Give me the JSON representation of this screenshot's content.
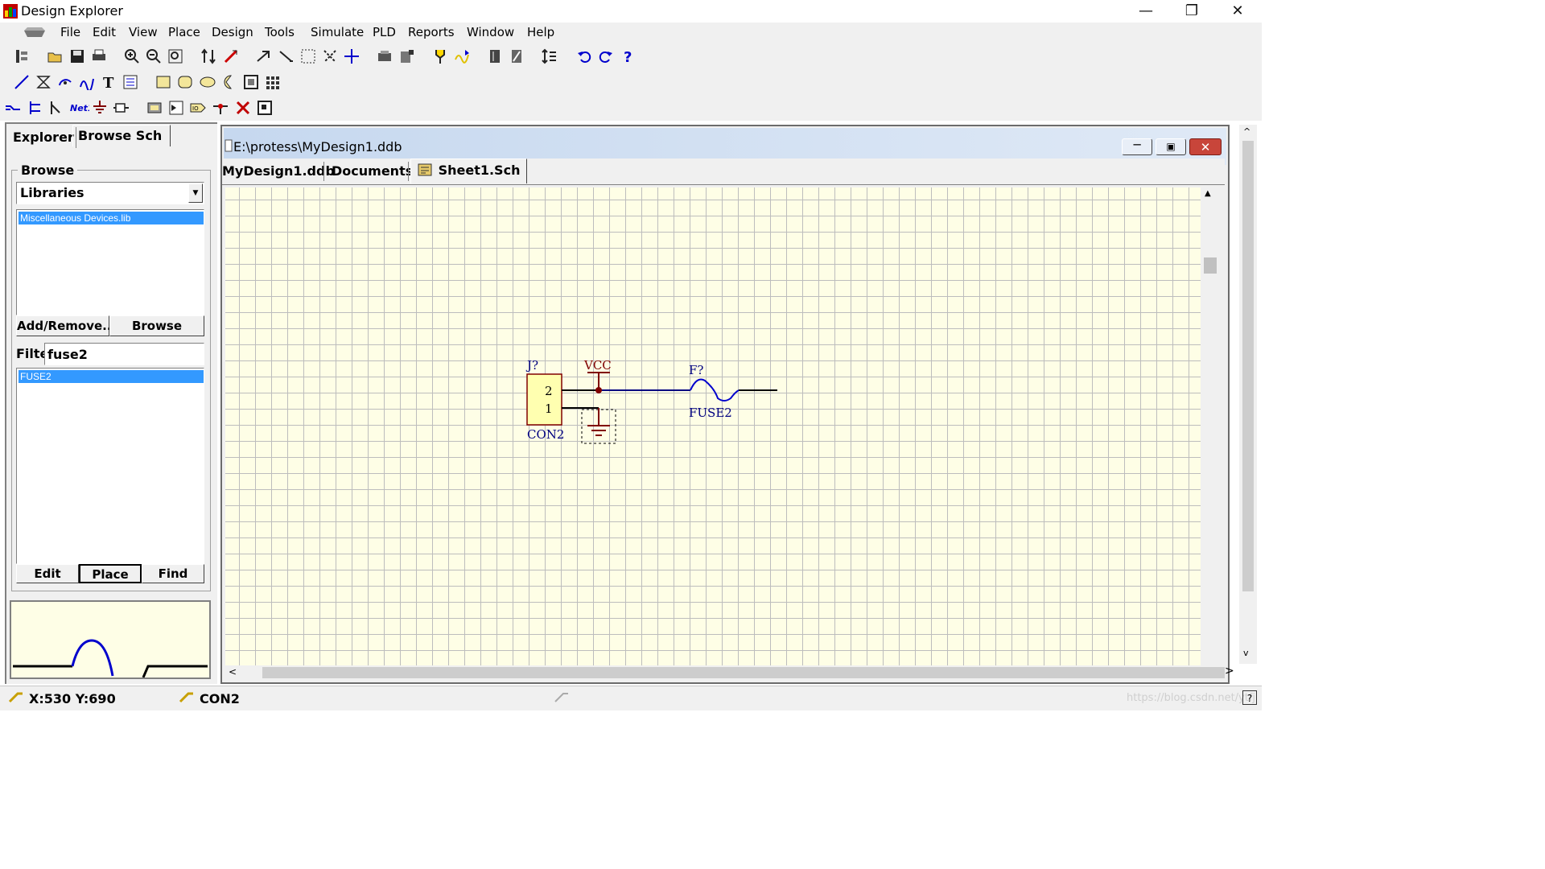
{
  "window": {
    "title": "Design Explorer"
  },
  "menu": [
    "File",
    "Edit",
    "View",
    "Place",
    "Design",
    "Tools",
    "Simulate",
    "PLD",
    "Reports",
    "Window",
    "Help"
  ],
  "panel": {
    "tabs": [
      "Explorer",
      "Browse Sch"
    ],
    "browse_label": "Browse",
    "browse_select": "Libraries",
    "libraries": [
      "Miscellaneous Devices.lib"
    ],
    "add_remove_label": "Add/Remove...",
    "browse_button": "Browse",
    "filter_label": "Filte",
    "filter_value": "fuse2",
    "components": [
      "FUSE2"
    ],
    "edit_button": "Edit",
    "place_button": "Place",
    "find_button": "Find"
  },
  "document": {
    "title": "E:\\protess\\MyDesign1.ddb",
    "tabs": [
      "MyDesign1.ddb",
      "Documents",
      "Sheet1.Sch"
    ]
  },
  "schematic": {
    "connector_designator": "J?",
    "connector_comment": "CON2",
    "pin_2": "2",
    "pin_1": "1",
    "power_label": "VCC",
    "fuse_designator": "F?",
    "fuse_comment": "FUSE2"
  },
  "status": {
    "coords": "X:530 Y:690",
    "component": "CON2",
    "watermark": "https://blog.csdn.net/ytfj"
  },
  "colors": {
    "canvas_bg": "#fefee6",
    "grid": "#bdbdbd",
    "wire": "#000080",
    "power": "#800000",
    "component_fill": "#ffffb0",
    "selection": "#3399ff"
  }
}
